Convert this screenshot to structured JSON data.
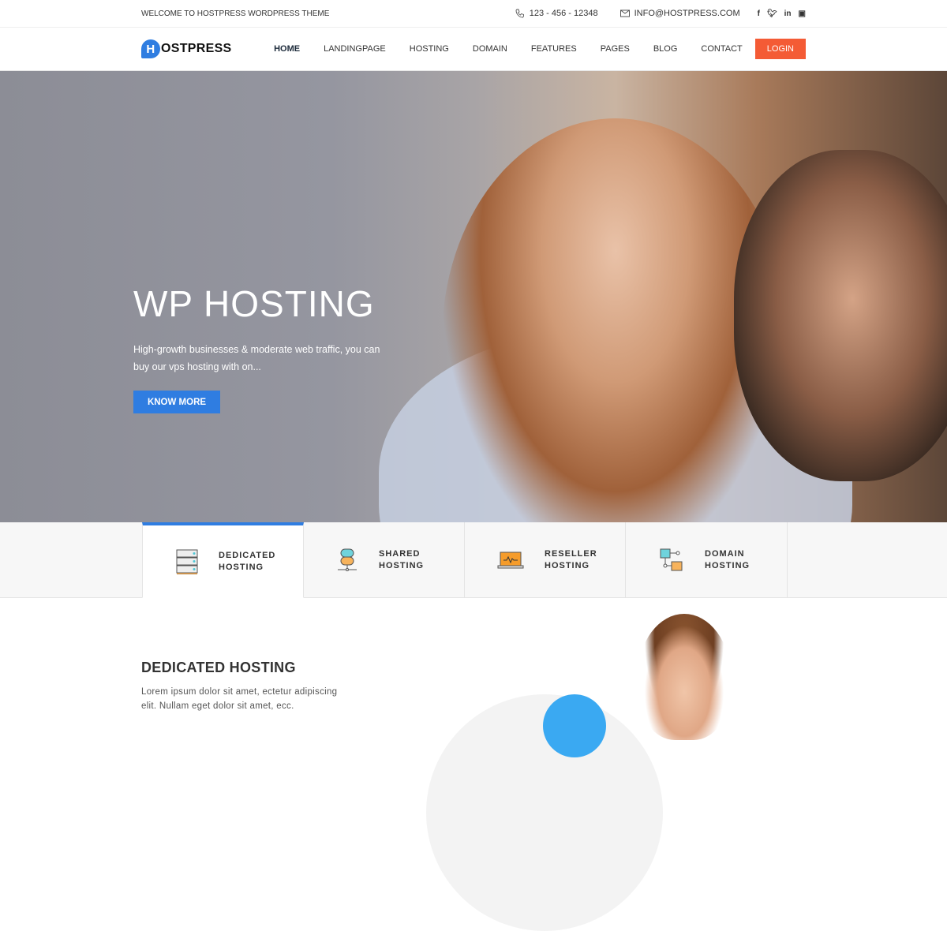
{
  "topbar": {
    "welcome": "WELCOME TO HOSTPRESS WORDPRESS THEME",
    "phone": "123 - 456 - 12348",
    "email": "INFO@HOSTPRESS.COM",
    "social": [
      "f",
      "t",
      "in",
      "yt"
    ]
  },
  "logo": {
    "letter": "H",
    "text": "OSTPRESS",
    "color": "#2f7de1"
  },
  "nav": {
    "items": [
      "HOME",
      "LANDINGPAGE",
      "HOSTING",
      "DOMAIN",
      "FEATURES",
      "PAGES",
      "BLOG",
      "CONTACT"
    ],
    "login": "LOGIN",
    "login_color": "#f45b35"
  },
  "hero": {
    "title": "WP HOSTING",
    "text": "High-growth businesses & moderate web traffic, you can buy our vps hosting with on...",
    "button": "KNOW MORE",
    "button_color": "#2f7de1"
  },
  "tabs": [
    {
      "line1": "DEDICATED",
      "line2": "HOSTING",
      "icon": "server-rack-icon",
      "active": true
    },
    {
      "line1": "SHARED",
      "line2": "HOSTING",
      "icon": "database-icon"
    },
    {
      "line1": "RESELLER",
      "line2": "HOSTING",
      "icon": "laptop-icon"
    },
    {
      "line1": "DOMAIN",
      "line2": "HOSTING",
      "icon": "network-icon"
    }
  ],
  "section": {
    "title": "DEDICATED HOSTING",
    "text": "Lorem ipsum dolor sit amet, ectetur adipiscing elit. Nullam eget dolor sit amet, ecc."
  }
}
